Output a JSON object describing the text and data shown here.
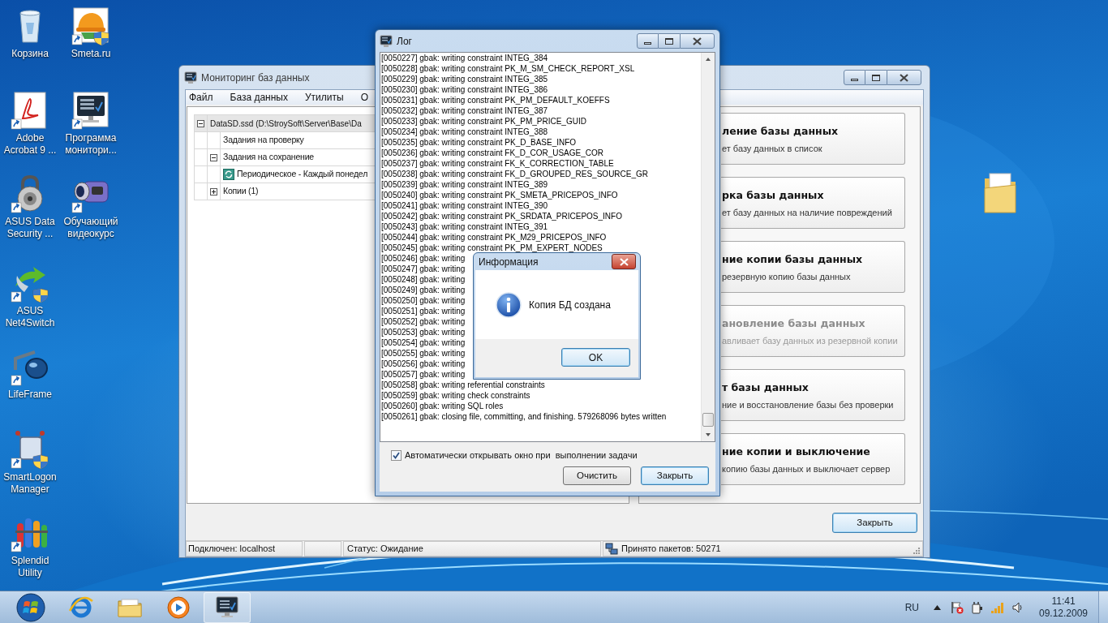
{
  "desktop": {
    "icons": [
      {
        "label": "Корзина",
        "kind": "bin"
      },
      {
        "label": "Smeta.ru",
        "kind": "helmet"
      },
      {
        "label": "Adobe Acrobat 9 ...",
        "kind": "document"
      },
      {
        "label": "Программа монитори...",
        "kind": "monitor"
      },
      {
        "label": "ASUS Data Security ...",
        "kind": "lock"
      },
      {
        "label": "Обучающий видеокурс",
        "kind": "camera"
      },
      {
        "label": "ASUS Net4Switch",
        "kind": "network"
      },
      {
        "label": "LifeFrame",
        "kind": "lens"
      },
      {
        "label": "SmartLogon Manager",
        "kind": "robot"
      },
      {
        "label": "Splendid Utility",
        "kind": "tubes"
      }
    ]
  },
  "monitor_window": {
    "title": "Мониторинг баз данных",
    "menu": [
      "Файл",
      "База данных",
      "Утилиты",
      "О"
    ],
    "tree": [
      {
        "label": "DataSD.ssd (D:\\StroySoft\\Server\\Base\\Da",
        "expanded": true,
        "children": [
          {
            "label": "Задания на проверку"
          },
          {
            "label": "Задания на сохранение",
            "expanded": true,
            "children": [
              {
                "label": "Периодическое - Каждый понедел",
                "kind": "task"
              }
            ]
          },
          {
            "label": "Копии (1)",
            "expanded": false
          }
        ]
      }
    ],
    "actions": [
      {
        "title": "ление базы данных",
        "description": "ет базу данных в список",
        "disabled": false
      },
      {
        "title": "рка базы данных",
        "description": "ет базу данных на наличие повреждений",
        "disabled": false
      },
      {
        "title": "ние копии базы данных",
        "description": "резервную копию базы данных",
        "disabled": false
      },
      {
        "title": "ановление базы данных",
        "description": "авливает базу данных из резервной копии",
        "disabled": true
      },
      {
        "title": "т базы данных",
        "description": "ние и восстановление базы без проверки",
        "disabled": false
      },
      {
        "title": "ние копии и выключение",
        "description": "копию базы данных и выключает сервер",
        "disabled": false
      }
    ],
    "close_button": "Закрыть",
    "status_bar": {
      "connection": "Подключен: localhost",
      "status": "Статус: Ожидание",
      "packets": "Принято пакетов: 50271"
    }
  },
  "log_window": {
    "title": "Лог",
    "lines": [
      "[0050227] gbak: writing constraint INTEG_384",
      "[0050228] gbak: writing constraint PK_M_SM_CHECK_REPORT_XSL",
      "[0050229] gbak: writing constraint INTEG_385",
      "[0050230] gbak: writing constraint INTEG_386",
      "[0050231] gbak: writing constraint PK_PM_DEFAULT_KOEFFS",
      "[0050232] gbak: writing constraint INTEG_387",
      "[0050233] gbak: writing constraint PK_PM_PRICE_GUID",
      "[0050234] gbak: writing constraint INTEG_388",
      "[0050235] gbak: writing constraint PK_D_BASE_INFO",
      "[0050236] gbak: writing constraint FK_D_COR_USAGE_COR",
      "[0050237] gbak: writing constraint FK_K_CORRECTION_TABLE",
      "[0050238] gbak: writing constraint FK_D_GROUPED_RES_SOURCE_GR",
      "[0050239] gbak: writing constraint INTEG_389",
      "[0050240] gbak: writing constraint PK_SMETA_PRICEPOS_INFO",
      "[0050241] gbak: writing constraint INTEG_390",
      "[0050242] gbak: writing constraint PK_SRDATA_PRICEPOS_INFO",
      "[0050243] gbak: writing constraint INTEG_391",
      "[0050244] gbak: writing constraint PK_M29_PRICEPOS_INFO",
      "[0050245] gbak: writing constraint PK_PM_EXPERT_NODES",
      "[0050246] gbak: writing",
      "[0050247] gbak: writing",
      "[0050248] gbak: writing",
      "[0050249] gbak: writing",
      "[0050250] gbak: writing",
      "[0050251] gbak: writing",
      "[0050252] gbak: writing",
      "[0050253] gbak: writing",
      "[0050254] gbak: writing",
      "[0050255] gbak: writing",
      "[0050256] gbak: writing",
      "[0050257] gbak: writing",
      "[0050258] gbak: writing referential constraints",
      "[0050259] gbak: writing check constraints",
      "[0050260] gbak: writing SQL roles",
      "[0050261] gbak: closing file, committing, and finishing. 579268096 bytes written"
    ],
    "auto_open": {
      "label": "Автоматически открывать окно при  выполнении задачи",
      "checked": true
    },
    "buttons": [
      {
        "label": "Очистить",
        "default": false
      },
      {
        "label": "Закрыть",
        "default": true
      }
    ]
  },
  "info_dialog": {
    "title": "Информация",
    "message": "Копия БД создана",
    "button": "OK"
  },
  "taskbar": {
    "apps": [
      {
        "kind": "browser",
        "selected": false
      },
      {
        "kind": "folder",
        "selected": false
      },
      {
        "kind": "media",
        "selected": false
      },
      {
        "kind": "monitor",
        "selected": true
      }
    ],
    "language": "RU",
    "time": "11:41",
    "date": "09.12.2009"
  }
}
